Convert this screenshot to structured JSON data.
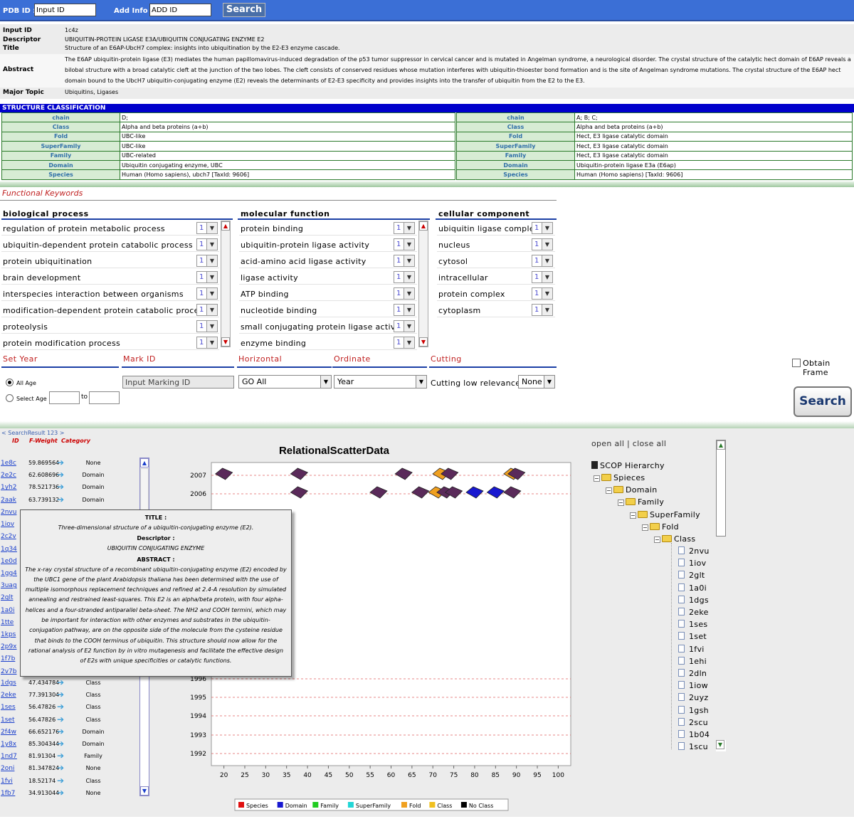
{
  "topbar": {
    "pdb_label": "PDB ID :",
    "pdb_value": "Input ID",
    "add_label": "Add Info :",
    "add_value": "ADD ID",
    "search_label": "Search"
  },
  "info": {
    "input_id_label": "Input ID",
    "input_id": "1c4z",
    "descriptor_label": "Descriptor",
    "descriptor": "UBIQUITIN-PROTEIN LIGASE E3A/UBIQUITIN CONJUGATING ENZYME E2",
    "title_label": "Title",
    "title": "Structure of an E6AP-UbcH7 complex: insights into ubiquitination by the E2-E3 enzyme cascade.",
    "abstract_label": "Abstract",
    "abstract": "The E6AP ubiquitin-protein ligase (E3) mediates the human papillomavirus-induced degradation of the p53 tumor suppressor in cervical cancer and is mutated in Angelman syndrome, a neurological disorder. The crystal structure of the catalytic hect domain of E6AP reveals a bilobal structure with a broad catalytic cleft at the junction of the two lobes. The cleft consists of conserved residues whose mutation interferes with ubiquitin-thioester bond formation and is the site of Angelman syndrome mutations. The crystal structure of the E6AP hect domain bound to the UbcH7 ubiquitin-conjugating enzyme (E2) reveals the determinants of E2-E3 specificity and provides insights into the transfer of ubiquitin from the E2 to the E3.",
    "topic_label": "Major Topic",
    "topic": "Ubiquitins, Ligases"
  },
  "structure": {
    "title": "STRUCTURE CLASSIFICATION",
    "left": [
      {
        "k": "chain",
        "v": "D;"
      },
      {
        "k": "Class",
        "v": "Alpha and beta proteins (a+b)"
      },
      {
        "k": "Fold",
        "v": "UBC-like"
      },
      {
        "k": "SuperFamily",
        "v": "UBC-like"
      },
      {
        "k": "Family",
        "v": "UBC-related"
      },
      {
        "k": "Domain",
        "v": "Ubiquitin conjugating enzyme, UBC"
      },
      {
        "k": "Species",
        "v": "Human (Homo sapiens), ubch7 [TaxId: 9606]"
      }
    ],
    "right": [
      {
        "k": "chain",
        "v": "A; B; C;"
      },
      {
        "k": "Class",
        "v": "Alpha and beta proteins (a+b)"
      },
      {
        "k": "Fold",
        "v": "Hect, E3 ligase catalytic domain"
      },
      {
        "k": "SuperFamily",
        "v": "Hect, E3 ligase catalytic domain"
      },
      {
        "k": "Family",
        "v": "Hect, E3 ligase catalytic domain"
      },
      {
        "k": "Domain",
        "v": "Ubiquitin-protein ligase E3a (E6ap)"
      },
      {
        "k": "Species",
        "v": "Human (Homo sapiens) [TaxId: 9606]"
      }
    ]
  },
  "keywords": {
    "title": "Functional Keywords",
    "bio_title": "biological process",
    "mol_title": "molecular function",
    "cell_title": "cellular component",
    "bio": [
      {
        "t": "regulation of protein metabolic process",
        "n": "1"
      },
      {
        "t": "ubiquitin-dependent protein catabolic process",
        "n": "1"
      },
      {
        "t": "protein ubiquitination",
        "n": "1"
      },
      {
        "t": "brain development",
        "n": "1"
      },
      {
        "t": "interspecies interaction between organisms",
        "n": "1"
      },
      {
        "t": "modification-dependent protein catabolic process",
        "n": "1"
      },
      {
        "t": "proteolysis",
        "n": "1"
      },
      {
        "t": "protein modification process",
        "n": "1"
      }
    ],
    "mol": [
      {
        "t": "protein binding",
        "n": "1"
      },
      {
        "t": "ubiquitin-protein ligase activity",
        "n": "1"
      },
      {
        "t": "acid-amino acid ligase activity",
        "n": "1"
      },
      {
        "t": "ligase activity",
        "n": "1"
      },
      {
        "t": "ATP binding",
        "n": "1"
      },
      {
        "t": "nucleotide binding",
        "n": "1"
      },
      {
        "t": "small conjugating protein ligase activity",
        "n": "1"
      },
      {
        "t": "enzyme binding",
        "n": "1"
      }
    ],
    "cell": [
      {
        "t": "ubiquitin ligase complex",
        "n": "1"
      },
      {
        "t": "nucleus",
        "n": "1"
      },
      {
        "t": "cytosol",
        "n": "1"
      },
      {
        "t": "intracellular",
        "n": "1"
      },
      {
        "t": "protein complex",
        "n": "1"
      },
      {
        "t": "cytoplasm",
        "n": "1"
      }
    ]
  },
  "options": {
    "set_year": "Set Year",
    "mark_id": "Mark ID",
    "horizontal": "Horizontal",
    "ordinate": "Ordinate",
    "cutting": "Cutting",
    "all_age": "All Age",
    "select_age": "Select Age",
    "to": "to",
    "mark_placeholder": "Input Marking ID",
    "horizontal_value": "GO All",
    "ordinate_value": "Year",
    "cutting_label": "Cutting low relevance",
    "cutting_value": "None",
    "obtain_frame": "Obtain Frame",
    "search": "Search"
  },
  "results": {
    "header": "< SearchResult  123 >",
    "col_id": "ID",
    "col_weight": "F-Weight",
    "col_cat": "Category",
    "rows_top": [
      {
        "id": "1e8c",
        "w": "59.869564",
        "c": "None"
      },
      {
        "id": "2e2c",
        "w": "62.608696",
        "c": "Domain"
      },
      {
        "id": "1yh2",
        "w": "78.521736",
        "c": "Domain"
      },
      {
        "id": "2aak",
        "w": "63.739132",
        "c": "Domain"
      }
    ],
    "ids_hidden": [
      "2nvu",
      "1iov",
      "2c2v",
      "1q34",
      "1e0d",
      "1gg4",
      "3uag",
      "2glt",
      "1a0i",
      "1tte",
      "1kps",
      "2p9x",
      "1f7b",
      "2v7b"
    ],
    "rows_bottom": [
      {
        "id": "1dgs",
        "w": "47.434784",
        "c": "Class"
      },
      {
        "id": "2eke",
        "w": "77.391304",
        "c": "Class"
      },
      {
        "id": "1ses",
        "w": "56.47826",
        "c": "Class"
      },
      {
        "id": "1set",
        "w": "56.47826",
        "c": "Class"
      },
      {
        "id": "2f4w",
        "w": "66.652176",
        "c": "Domain"
      },
      {
        "id": "1y8x",
        "w": "85.304344",
        "c": "Domain"
      },
      {
        "id": "1nd7",
        "w": "81.91304",
        "c": "Family"
      },
      {
        "id": "2oni",
        "w": "81.347824",
        "c": "None"
      },
      {
        "id": "1fvi",
        "w": "18.52174",
        "c": "Class"
      },
      {
        "id": "1fb7",
        "w": "34.913044",
        "c": "None"
      }
    ]
  },
  "tooltip": {
    "title_h": "TITLE :",
    "title": "Three-dimensional structure of a ubiquitin-conjugating enzyme (E2).",
    "desc_h": "Descriptor :",
    "desc": "UBIQUITIN CONJUGATING ENZYME",
    "abs_h": "ABSTRACT :",
    "abstract": "The x-ray crystal structure of a recombinant ubiquitin-conjugating enzyme (E2) encoded by the UBC1 gene of the plant Arabidopsis thaliana has been determined with the use of multiple isomorphous replacement techniques and refined at 2.4-A resolution by simulated annealing and restrained least-squares. This E2 is an alpha/beta protein, with four alpha-helices and a four-stranded antiparallel beta-sheet. The NH2 and COOH termini, which may be important for interaction with other enzymes and substrates in the ubiquitin-conjugation pathway, are on the opposite side of the molecule from the cysteine residue that binds to the COOH terminus of ubiquitin. This structure should now allow for the rational analysis of E2 function by in vitro mutagenesis and facilitate the effective design of E2s with unique specificities or catalytic functions."
  },
  "tree": {
    "controls": "open all | close all",
    "root": "SCOP Hierarchy",
    "folders": [
      "Spieces",
      "Domain",
      "Family",
      "SuperFamily",
      "Fold",
      "Class"
    ],
    "leaves": [
      "2nvu",
      "1iov",
      "2glt",
      "1a0i",
      "1dgs",
      "2eke",
      "1ses",
      "1set",
      "1fvi",
      "1ehi",
      "2dln",
      "1iow",
      "2uyz",
      "1gsh",
      "2scu",
      "1b04",
      "1scu"
    ]
  },
  "chart_data": {
    "type": "scatter",
    "title": "RelationalScatterData",
    "xlim": [
      17,
      103
    ],
    "x_ticks": [
      20,
      25,
      30,
      35,
      40,
      45,
      50,
      55,
      60,
      65,
      70,
      75,
      80,
      85,
      90,
      95,
      100
    ],
    "y_ticks": [
      1992,
      1993,
      1994,
      1995,
      1996,
      2006,
      2007
    ],
    "grid": true,
    "legend_position": "bottom",
    "legend": [
      {
        "name": "Species",
        "color": "#e01010"
      },
      {
        "name": "Domain",
        "color": "#1818d0"
      },
      {
        "name": "Family",
        "color": "#22cc22"
      },
      {
        "name": "SuperFamily",
        "color": "#22d6d6"
      },
      {
        "name": "Fold",
        "color": "#f0a020"
      },
      {
        "name": "Class",
        "color": "#f0c020"
      },
      {
        "name": "No Class",
        "color": "#000000"
      }
    ],
    "points": [
      {
        "x": 20,
        "y": 2007,
        "cat": "None"
      },
      {
        "x": 38,
        "y": 2007,
        "cat": "None"
      },
      {
        "x": 63,
        "y": 2007,
        "cat": "None"
      },
      {
        "x": 72,
        "y": 2007,
        "cat": "Fold"
      },
      {
        "x": 74,
        "y": 2007,
        "cat": "None"
      },
      {
        "x": 89,
        "y": 2007,
        "cat": "Fold"
      },
      {
        "x": 90,
        "y": 2007,
        "cat": "None"
      },
      {
        "x": 38,
        "y": 2006,
        "cat": "None"
      },
      {
        "x": 57,
        "y": 2006,
        "cat": "None"
      },
      {
        "x": 67,
        "y": 2006,
        "cat": "None"
      },
      {
        "x": 71,
        "y": 2006,
        "cat": "Fold"
      },
      {
        "x": 73,
        "y": 2006,
        "cat": "None"
      },
      {
        "x": 75,
        "y": 2006,
        "cat": "None"
      },
      {
        "x": 80,
        "y": 2006,
        "cat": "Domain"
      },
      {
        "x": 85,
        "y": 2006,
        "cat": "Domain"
      },
      {
        "x": 89,
        "y": 2006,
        "cat": "None"
      }
    ]
  }
}
